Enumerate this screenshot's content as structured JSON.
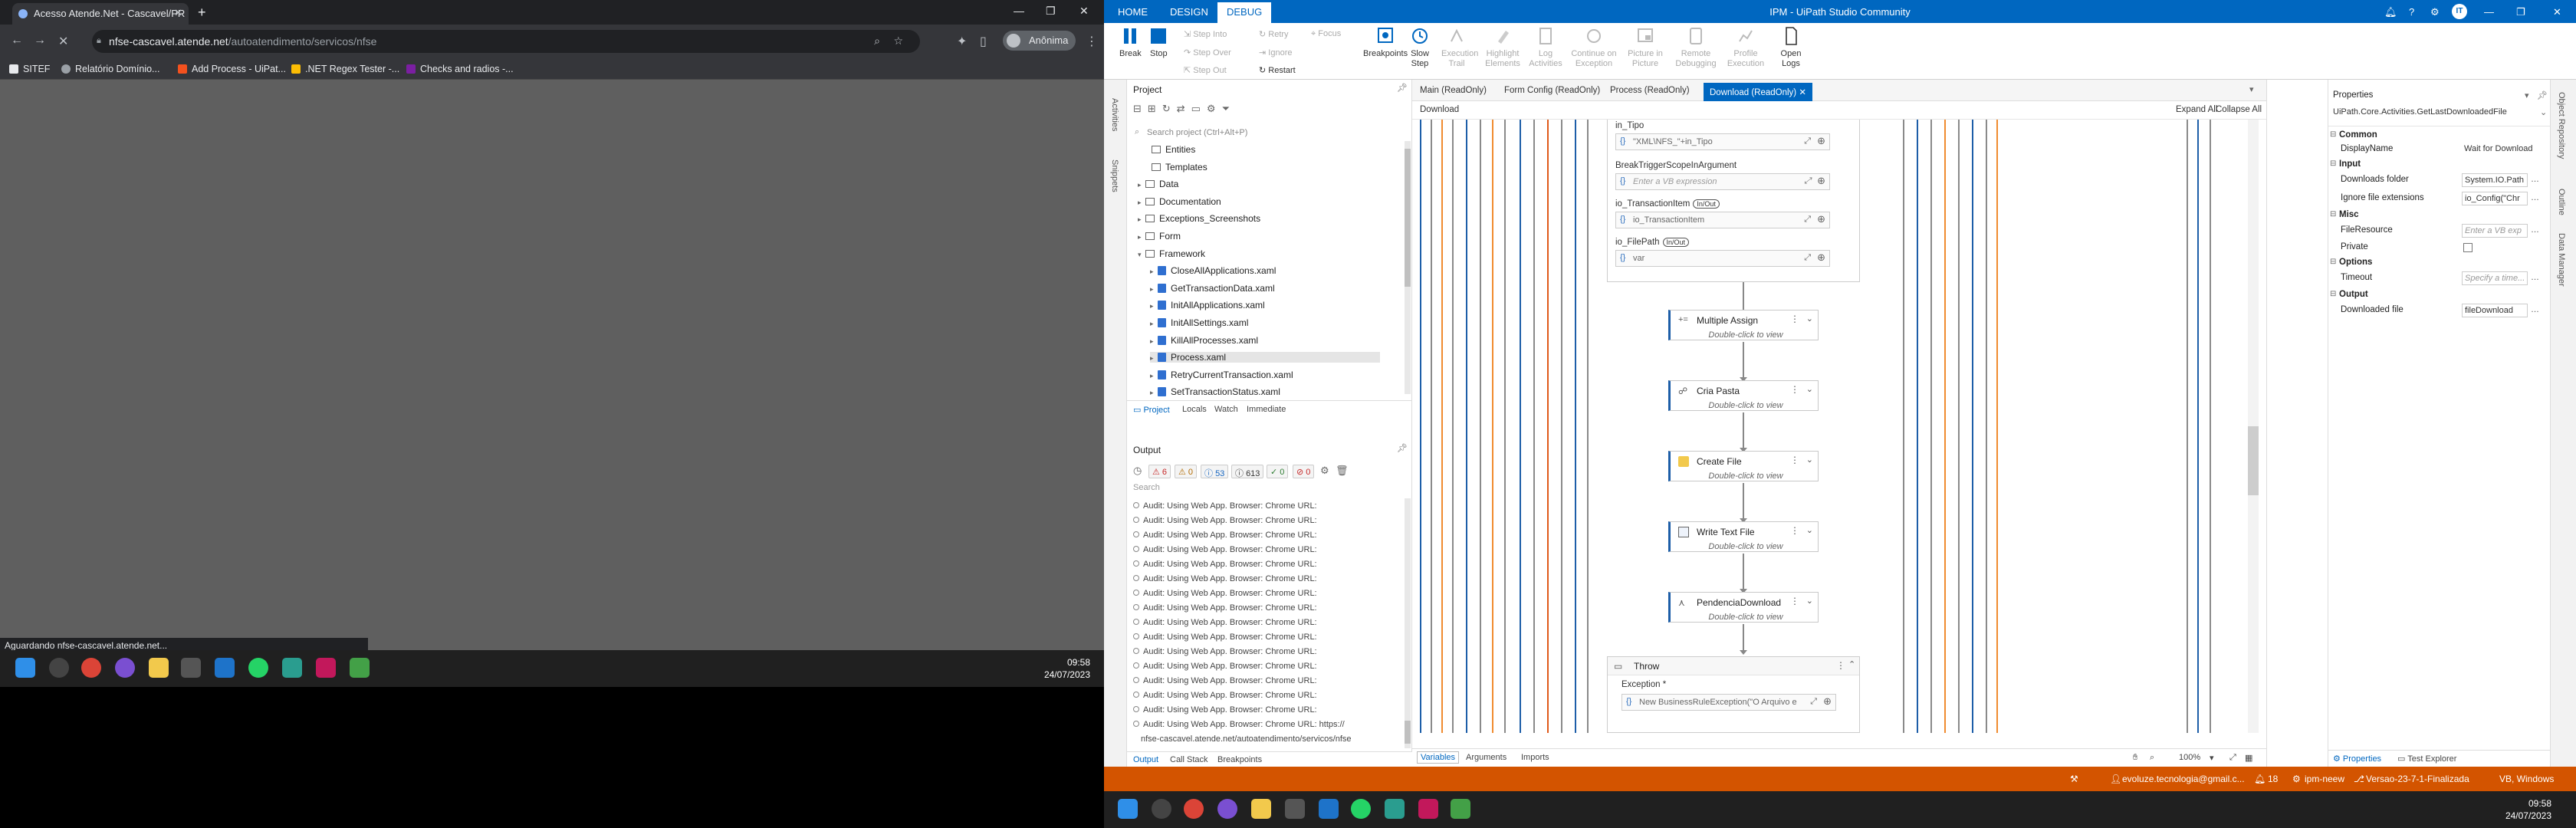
{
  "chrome": {
    "tab_title": "Acesso Atende.Net - Cascavel/PR",
    "url_host": "nfse-cascavel.atende.net",
    "url_path": "/autoatendimento/servicos/nfse",
    "profile_label": "Anônima",
    "bookmarks": [
      {
        "label": "SITEF",
        "color": "#e8eaed"
      },
      {
        "label": "Relatório Domínio...",
        "color": "#9aa0a6"
      },
      {
        "label": "Add Process - UiPat...",
        "color": "#f4511e"
      },
      {
        "label": ".NET Regex Tester -...",
        "color": "#fbbc04"
      },
      {
        "label": "Checks and radios -...",
        "color": "#7b1fa2"
      }
    ],
    "status_text": "Aguardando nfse-cascavel.atende.net...",
    "clock_time": "09:58",
    "clock_date": "24/07/2023"
  },
  "studio": {
    "title": "IPM - UiPath Studio Community",
    "ribbon_tabs": [
      "HOME",
      "DESIGN",
      "DEBUG"
    ],
    "avatar": "IT",
    "ribbon": {
      "break": "Break",
      "stop": "Stop",
      "step_into": "Step Into",
      "step_over": "Step Over",
      "step_out": "Step Out",
      "retry": "Retry",
      "ignore": "Ignore",
      "restart": "Restart",
      "focus": "Focus",
      "breakpoints": "Breakpoints",
      "slow_step": "Slow Step",
      "execution_trail": "Execution Trail",
      "highlight_elements": "Highlight Elements",
      "log_activities": "Log Activities",
      "continue_on_exception": "Continue on Exception",
      "picture_in_picture": "Picture in Picture",
      "remote_debugging": "Remote Debugging",
      "profile_execution": "Profile Execution",
      "open_logs": "Open Logs"
    },
    "project": {
      "title": "Project",
      "search_placeholder": "Search project (Ctrl+Alt+P)",
      "items": [
        {
          "label": "Entities",
          "type": "special"
        },
        {
          "label": "Templates",
          "type": "folder"
        },
        {
          "label": "Data",
          "type": "folder"
        },
        {
          "label": "Documentation",
          "type": "folder"
        },
        {
          "label": "Exceptions_Screenshots",
          "type": "folder"
        },
        {
          "label": "Form",
          "type": "folder"
        },
        {
          "label": "Framework",
          "type": "folder"
        },
        {
          "label": "CloseAllApplications.xaml",
          "type": "file"
        },
        {
          "label": "GetTransactionData.xaml",
          "type": "file"
        },
        {
          "label": "InitAllApplications.xaml",
          "type": "file"
        },
        {
          "label": "InitAllSettings.xaml",
          "type": "file"
        },
        {
          "label": "KillAllProcesses.xaml",
          "type": "file"
        },
        {
          "label": "Process.xaml",
          "type": "file"
        },
        {
          "label": "RetryCurrentTransaction.xaml",
          "type": "file"
        },
        {
          "label": "SetTransactionStatus.xaml",
          "type": "file"
        }
      ],
      "tabs": [
        "Project",
        "Locals",
        "Watch",
        "Immediate"
      ]
    },
    "output": {
      "title": "Output",
      "badges": [
        "6",
        "0",
        "53",
        "613",
        "0",
        "0"
      ],
      "search_placeholder": "Search",
      "lines": [
        "Audit: Using Web App. Browser: Chrome URL:",
        "Audit: Using Web App. Browser: Chrome URL:",
        "Audit: Using Web App. Browser: Chrome URL:",
        "Audit: Using Web App. Browser: Chrome URL:",
        "Audit: Using Web App. Browser: Chrome URL:",
        "Audit: Using Web App. Browser: Chrome URL:",
        "Audit: Using Web App. Browser: Chrome URL:",
        "Audit: Using Web App. Browser: Chrome URL:",
        "Audit: Using Web App. Browser: Chrome URL:",
        "Audit: Using Web App. Browser: Chrome URL:",
        "Audit: Using Web App. Browser: Chrome URL:",
        "Audit: Using Web App. Browser: Chrome URL:",
        "Audit: Using Web App. Browser: Chrome URL:",
        "Audit: Using Web App. Browser: Chrome URL:",
        "Audit: Using Web App. Browser: Chrome URL:",
        "Audit: Using Web App. Browser: Chrome URL: https://",
        "nfse-cascavel.atende.net/autoatendimento/servicos/nfse"
      ]
    },
    "bottom_tabs": [
      "Output",
      "Call Stack",
      "Breakpoints"
    ],
    "doc_tabs": [
      "Main (ReadOnly)",
      "Form Config (ReadOnly)",
      "Process (ReadOnly)",
      "Download (ReadOnly)"
    ],
    "breadcrumb": "Download",
    "expand_all": "Expand All",
    "collapse_all": "Collapse All",
    "args": [
      {
        "label": "in_Tipo",
        "tag": "",
        "value": "\"XML\\NFS_\"+in_Tipo",
        "placeholder": false
      },
      {
        "label": "BreakTriggerScopeInArgument",
        "tag": "",
        "value": "Enter a VB expression",
        "placeholder": true
      },
      {
        "label": "io_TransactionItem",
        "tag": "In/Out",
        "value": "io_TransactionItem",
        "placeholder": false
      },
      {
        "label": "io_FilePath",
        "tag": "In/Out",
        "value": "var",
        "placeholder": false
      }
    ],
    "activities": [
      {
        "name": "Multiple Assign",
        "hint": "Double-click to view"
      },
      {
        "name": "Cria Pasta",
        "hint": "Double-click to view"
      },
      {
        "name": "Create File",
        "hint": "Double-click to view"
      },
      {
        "name": "Write Text File",
        "hint": "Double-click to view"
      },
      {
        "name": "PendenciaDownload",
        "hint": "Double-click to view"
      }
    ],
    "throw": {
      "name": "Throw",
      "field": "Exception *",
      "value": "New BusinessRuleException(\"O Arquivo e"
    },
    "canvas_foot": {
      "variables": "Variables",
      "arguments": "Arguments",
      "imports": "Imports",
      "zoom": "100%"
    },
    "properties": {
      "title": "Properties",
      "type": "UiPath.Core.Activities.GetLastDownloadedFile",
      "sections": {
        "common": "Common",
        "input": "Input",
        "misc": "Misc",
        "options": "Options",
        "output": "Output"
      },
      "display_name_label": "DisplayName",
      "display_name_value": "Wait for Download",
      "downloads_folder_label": "Downloads folder",
      "downloads_folder_value": "System.IO.Path",
      "ignore_ext_label": "Ignore file extensions",
      "ignore_ext_value": "io_Config(\"Chr",
      "file_resource_label": "FileResource",
      "file_resource_value": "Enter a VB exp",
      "private_label": "Private",
      "timeout_label": "Timeout",
      "timeout_value": "Specify a time...",
      "downloaded_file_label": "Downloaded file",
      "downloaded_file_value": "fileDownload"
    },
    "props_tabs": [
      "Properties",
      "Test Explorer"
    ],
    "status": {
      "account": "evoluze.tecnologia@gmail.c...",
      "count": "18",
      "robot": "ipm-neew",
      "branch": "Versao-23-7-1-Finalizada",
      "lang": "VB, Windows"
    },
    "clock_time": "09:58",
    "clock_date": "24/07/2023"
  },
  "colors": {
    "studio_blue": "#0067c0",
    "status_orange": "#d35400",
    "chrome_dark": "#202124"
  }
}
